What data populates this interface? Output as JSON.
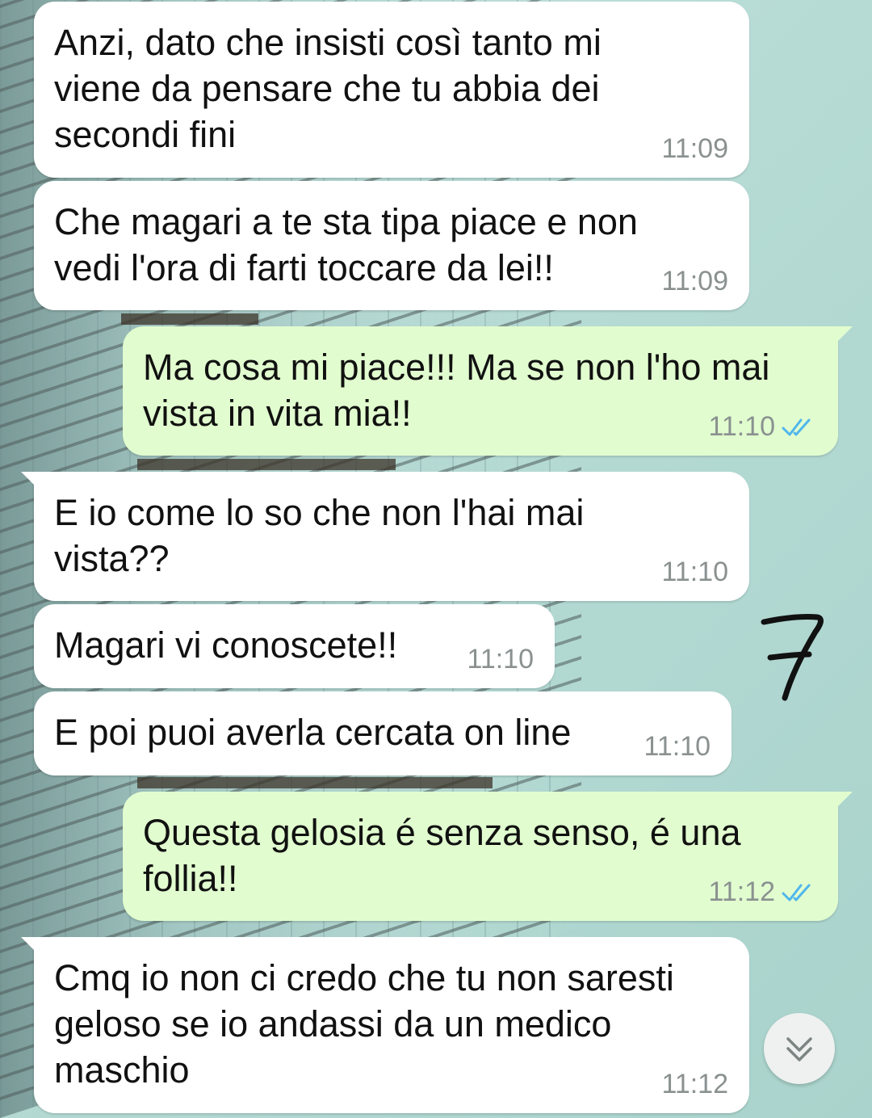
{
  "messages": [
    {
      "direction": "incoming",
      "text": "Anzi, dato che insisti così tanto mi\nviene da pensare che tu abbia dei\nsecondi fini",
      "time": "11:09"
    },
    {
      "direction": "incoming",
      "text": "Che magari a te sta tipa piace e non\nvedi l'ora di farti toccare da lei!!",
      "time": "11:09"
    },
    {
      "direction": "outgoing",
      "text": "Ma cosa mi piace!!! Ma se non l'ho mai\nvista in vita mia!!",
      "time": "11:10",
      "status": "read"
    },
    {
      "direction": "incoming",
      "text": "E io come lo so che non l'hai mai\nvista??",
      "time": "11:10"
    },
    {
      "direction": "incoming",
      "text": "Magari vi conoscete!!",
      "time": "11:10"
    },
    {
      "direction": "incoming",
      "text": "E poi puoi averla cercata on line",
      "time": "11:10"
    },
    {
      "direction": "outgoing",
      "text": "Questa gelosia é senza senso, é una\nfollia!!",
      "time": "11:12",
      "status": "read"
    },
    {
      "direction": "incoming",
      "text": "Cmq io non ci credo che tu non saresti\ngeloso se io andassi da un medico\nmaschio",
      "time": "11:12"
    }
  ],
  "annotation": "7",
  "icons": {
    "read_receipt": "double-check-icon",
    "scroll_down": "chevron-double-down-icon"
  },
  "colors": {
    "incoming_bubble": "#ffffff",
    "outgoing_bubble": "#e1fdcf",
    "read_tick": "#4fb6ec",
    "timestamp": "#8a9190"
  }
}
